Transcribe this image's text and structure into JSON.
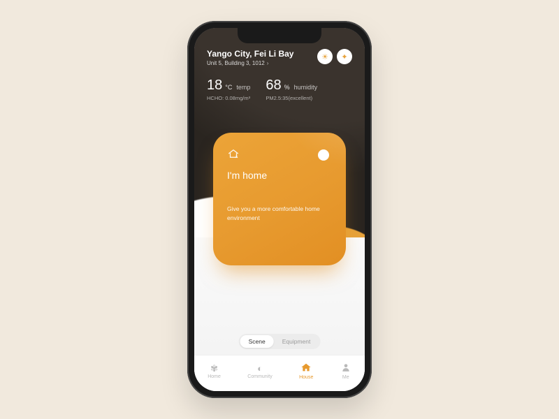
{
  "location": {
    "title": "Yango City, Fei Li Bay",
    "subtitle": "Unit 5, Building 3, 1012"
  },
  "header_icons": [
    "sun-icon",
    "lamp-icon"
  ],
  "stats": {
    "temp": {
      "value": "18",
      "unit": "°C",
      "label": "temp",
      "sub": "HCHO: 0.08mg/m³"
    },
    "humidity": {
      "value": "68",
      "unit": "%",
      "label": "humidity",
      "sub": "PM2.5:35(excellent)"
    }
  },
  "card": {
    "icon": "home-run-icon",
    "title": "I'm home",
    "desc": "Give you a more comfortable home environment"
  },
  "segment": {
    "items": [
      "Scene",
      "Equipment"
    ],
    "active": 0
  },
  "tabs": {
    "items": [
      {
        "icon": "medal-icon",
        "label": "Home"
      },
      {
        "icon": "globe-icon",
        "label": "Community"
      },
      {
        "icon": "house-icon",
        "label": "House"
      },
      {
        "icon": "person-icon",
        "label": "Me"
      }
    ],
    "active": 2
  },
  "colors": {
    "accent": "#e79a2f",
    "card": "#e7a23a",
    "bg": "#f1e9dd"
  }
}
